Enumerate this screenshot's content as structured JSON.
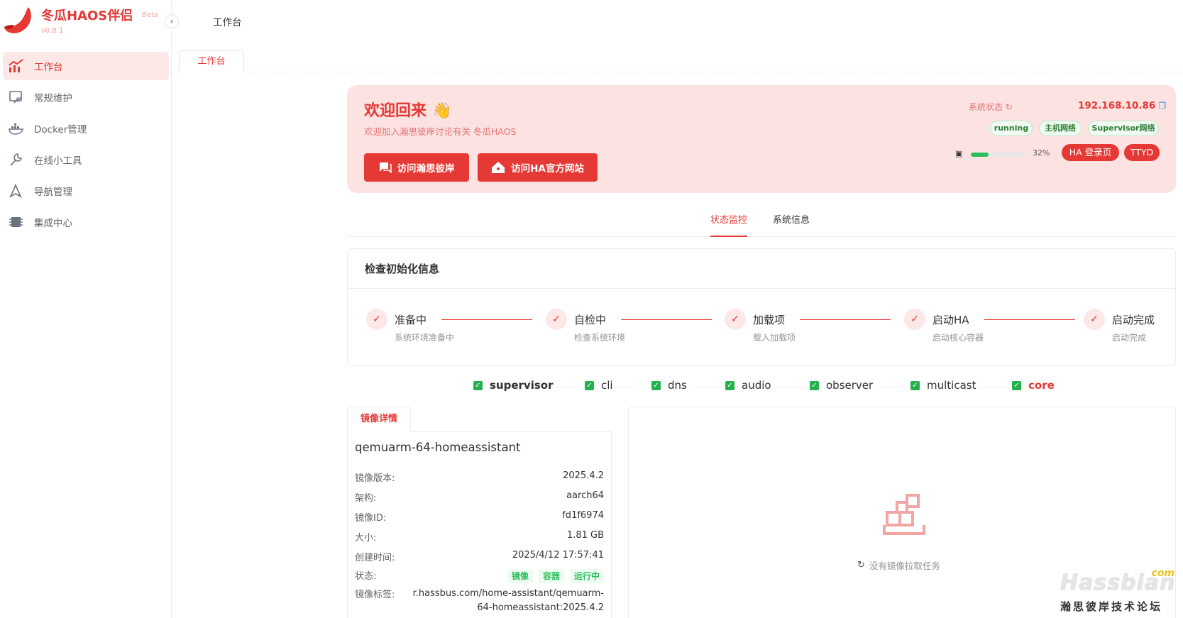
{
  "brand": {
    "title": "冬瓜HAOS伴侣",
    "beta": "Beta",
    "version": "v0.8.1",
    "accent": "#e53935"
  },
  "sidebar": {
    "collapse_icon": "chevron-left-icon",
    "items": [
      {
        "label": "工作台",
        "icon": "dashboard-chart-icon",
        "active": true
      },
      {
        "label": "常规维护",
        "icon": "maintenance-icon"
      },
      {
        "label": "Docker管理",
        "icon": "docker-icon"
      },
      {
        "label": "在线小工具",
        "icon": "wrench-icon"
      },
      {
        "label": "导航管理",
        "icon": "navigation-icon"
      },
      {
        "label": "集成中心",
        "icon": "integration-icon"
      }
    ]
  },
  "header": {
    "title": "工作台",
    "tab": "工作台"
  },
  "welcome": {
    "title": "欢迎回来",
    "emoji": "👋",
    "subtitle": "欢迎加入瀚思彼岸讨论有关 冬瓜HAOS",
    "btn_forum": "访问瀚思彼岸",
    "btn_ha": "访问HA官方网站",
    "sys_status_label": "系统状态",
    "ip": "192.168.10.86",
    "tags": [
      "running",
      "主机网络",
      "Supervisor网络"
    ],
    "disk_percent": 32,
    "disk_percent_text": "32%",
    "btn_ha_login": "HA 登录页",
    "btn_ttyd": "TTYD"
  },
  "tabs": {
    "status": "状态监控",
    "sysinfo": "系统信息"
  },
  "init": {
    "title": "检查初始化信息",
    "steps": [
      {
        "title": "准备中",
        "desc": "系统环境准备中"
      },
      {
        "title": "自检中",
        "desc": "检查系统环境"
      },
      {
        "title": "加载项",
        "desc": "载入加载项"
      },
      {
        "title": "启动HA",
        "desc": "启动核心容器"
      },
      {
        "title": "启动完成",
        "desc": "启动完成"
      }
    ]
  },
  "containers": [
    "supervisor",
    "cli",
    "dns",
    "audio",
    "observer",
    "multicast",
    "core"
  ],
  "image": {
    "tab": "镜像详情",
    "name": "qemuarm-64-homeassistant",
    "rows": [
      {
        "label": "镜像版本:",
        "value": "2025.4.2"
      },
      {
        "label": "架构:",
        "value": "aarch64"
      },
      {
        "label": "镜像ID:",
        "value": "fd1f6974"
      },
      {
        "label": "大小:",
        "value": "1.81 GB"
      },
      {
        "label": "创建时间:",
        "value": "2025/4/12 17:57:41"
      }
    ],
    "status_label": "状态:",
    "status_tags": [
      "镜像",
      "容器",
      "运行中"
    ],
    "tag_label": "镜像标签:",
    "tag_value": "r.hassbus.com/home-assistant/qemuarm-64-homeassistant:2025.4.2"
  },
  "pull": {
    "empty_text": "没有镜像拉取任务",
    "icon": "boxes-icon"
  },
  "watermark": {
    "main": "Hassbian",
    "com": "com",
    "sub": "瀚思彼岸技术论坛"
  }
}
